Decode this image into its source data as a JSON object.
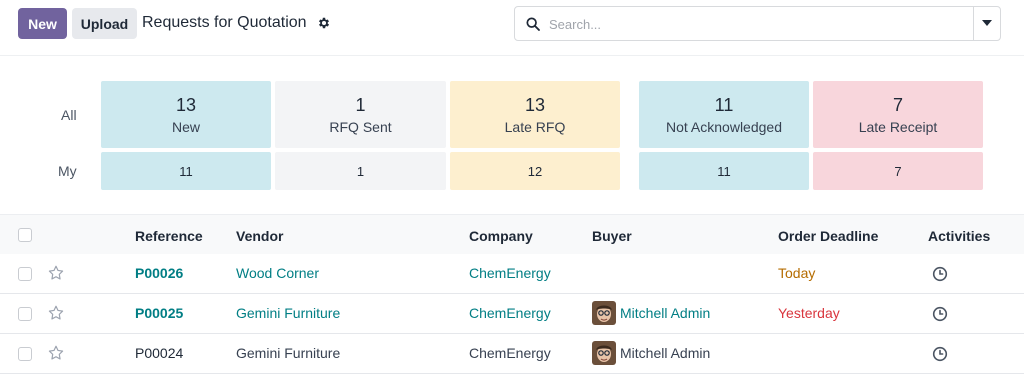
{
  "toolbar": {
    "new_label": "New",
    "upload_label": "Upload",
    "title": "Requests for Quotation",
    "search_placeholder": "Search..."
  },
  "dashboard": {
    "row_all_label": "All",
    "row_my_label": "My",
    "tiles": [
      {
        "all": "13",
        "label": "New",
        "my": "11",
        "color": "#cde9ef"
      },
      {
        "all": "1",
        "label": "RFQ Sent",
        "my": "1",
        "color": "#f3f4f6"
      },
      {
        "all": "13",
        "label": "Late RFQ",
        "my": "12",
        "color": "#fdefcf"
      },
      {
        "all": "11",
        "label": "Not Acknowledged",
        "my": "11",
        "color": "#cde9ef"
      },
      {
        "all": "7",
        "label": "Late Receipt",
        "my": "7",
        "color": "#f8d6dc"
      }
    ]
  },
  "table": {
    "columns": [
      "Reference",
      "Vendor",
      "Company",
      "Buyer",
      "Order Deadline",
      "Activities"
    ],
    "rows": [
      {
        "reference": "P00026",
        "vendor": "Wood Corner",
        "company": "ChemEnergy",
        "buyer": "",
        "deadline": "Today"
      },
      {
        "reference": "P00025",
        "vendor": "Gemini Furniture",
        "company": "ChemEnergy",
        "buyer": "Mitchell Admin",
        "deadline": "Yesterday"
      },
      {
        "reference": "P00024",
        "vendor": "Gemini Furniture",
        "company": "ChemEnergy",
        "buyer": "Mitchell Admin",
        "deadline": ""
      }
    ]
  },
  "colors": {
    "primary": "#71639e",
    "link": "#017e84",
    "today": "#b56c00",
    "overdue": "#d9363e"
  },
  "icons": {
    "settings": "gear-icon",
    "search": "search-icon",
    "dropdown": "caret-down-icon",
    "favorite": "star-icon",
    "activity": "clock-icon"
  }
}
